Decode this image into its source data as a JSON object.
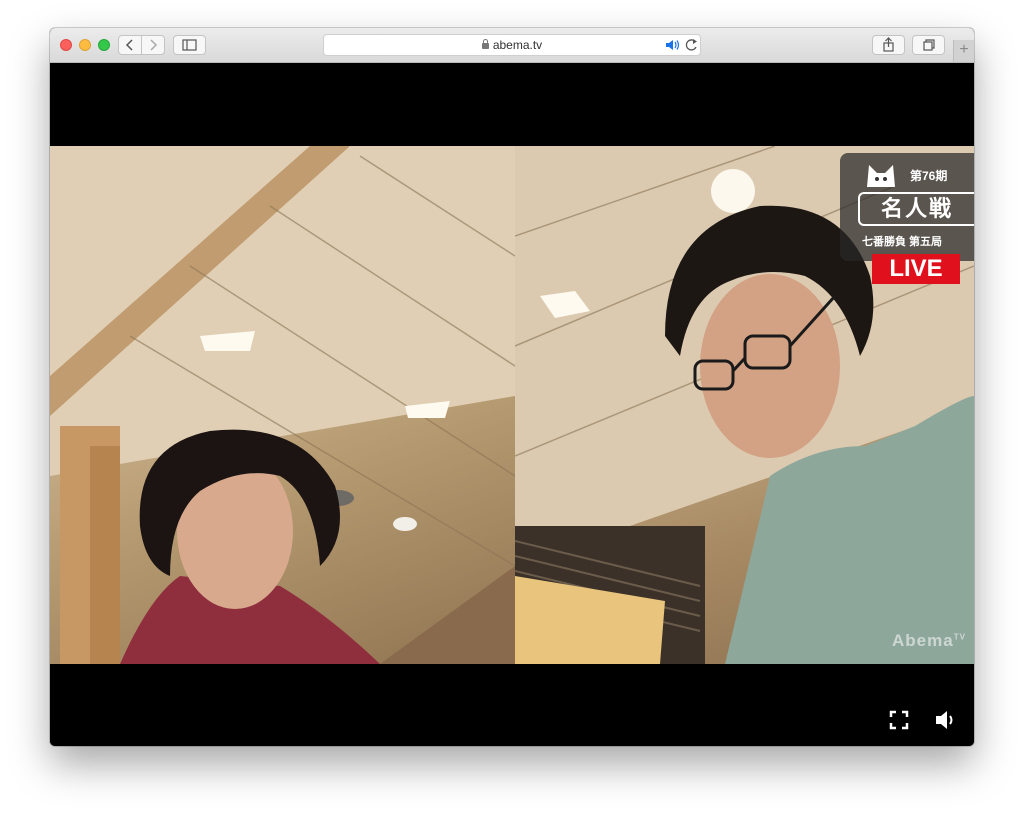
{
  "browser": {
    "address": "abema.tv",
    "new_tab_label": "+"
  },
  "overlay": {
    "season": "第76期",
    "title": "名人戦",
    "round": "七番勝負 第五局",
    "live": "LIVE"
  },
  "watermark": {
    "text": "Abema",
    "suffix": "TV"
  },
  "icons": {
    "back": "chevron-left-icon",
    "forward": "chevron-right-icon",
    "sidebar": "sidebar-icon",
    "audio": "speaker-icon",
    "reload": "reload-icon",
    "share": "share-icon",
    "tabs": "tabs-icon",
    "fullscreen": "fullscreen-icon",
    "volume": "volume-icon"
  },
  "colors": {
    "live_red": "#e0101d",
    "audio_blue": "#1a73e8"
  }
}
